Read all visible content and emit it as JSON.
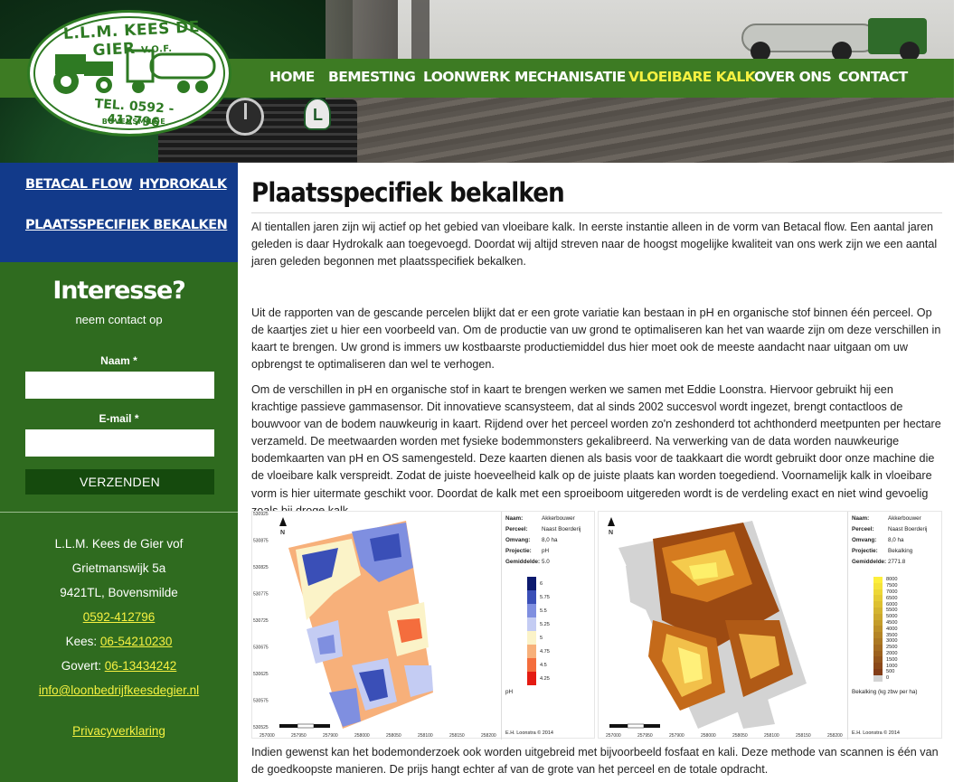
{
  "logo": {
    "title": "L.L.M. KEES DE GIER",
    "suffix": "V.O.F.",
    "phone": "TEL. 0592 - 412796",
    "town": "BOVENSMILDE"
  },
  "nav": {
    "items": [
      "HOME",
      "BEMESTING",
      "LOONWERK",
      "MECHANISATIE",
      "VLOEIBARE KALK",
      "OVER ONS",
      "CONTACT"
    ],
    "active": "VLOEIBARE KALK",
    "active_color": "#f6f141"
  },
  "sidebar": {
    "sub_links": [
      "BETACAL FLOW",
      "HYDROKALK",
      "PLAATSSPECIFIEK BEKALKEN"
    ],
    "interest_title": "Interesse?",
    "interest_sub": "neem contact op",
    "name_label": "Naam *",
    "email_label": "E-mail *",
    "submit_label": "VERZENDEN",
    "company": "L.L.M. Kees de Gier vof",
    "street": "Grietmanswijk 5a",
    "city": "9421TL, Bovensmilde",
    "phone": "0592-412796",
    "kees_label": "Kees:",
    "kees_phone": "06-54210230",
    "govert_label": "Govert:",
    "govert_phone": "06-13434242",
    "email": "info@loonbedrijfkeesdegier.nl",
    "privacy": "Privacyverklaring"
  },
  "main": {
    "title": "Plaatsspecifiek bekalken",
    "p1": "Al tientallen jaren zijn wij actief op het gebied van vloeibare kalk. In eerste instantie alleen in de vorm van Betacal flow. Een aantal jaren geleden is daar Hydrokalk aan toegevoegd. Doordat wij altijd streven naar de hoogst mogelijke kwaliteit van ons werk zijn we een aantal jaren geleden begonnen met plaatsspecifiek bekalken.",
    "p2": "Uit de rapporten van de gescande percelen blijkt dat er een grote variatie kan bestaan in pH en organische stof binnen één perceel. Op de kaartjes ziet u hier een voorbeeld van. Om de productie van uw grond te optimaliseren kan het van waarde zijn om deze verschillen in kaart te brengen. Uw grond is immers uw kostbaarste productiemiddel dus hier moet ook de meeste aandacht naar uitgaan om uw opbrengst te optimaliseren dan wel te verhogen.",
    "p3": "Om de verschillen in pH en organische stof in kaart te brengen werken we samen met Eddie Loonstra. Hiervoor gebruikt hij een krachtige passieve gammasensor. Dit innovatieve scansysteem, dat al sinds 2002 succesvol wordt ingezet, brengt contactloos de bouwvoor van de bodem nauwkeurig in kaart. Rijdend over het perceel worden zo'n zeshonderd tot achthonderd meetpunten per hectare verzameld. De meetwaarden worden met fysieke bodemmonsters gekalibreerd. Na verwerking van de data worden nauwkeurige bodemkaarten van pH en OS samengesteld. Deze kaarten dienen als basis voor de taakkaart die wordt gebruikt door onze machine die de vloeibare kalk verspreidt. Zodat de juiste hoeveelheid kalk op de juiste plaats kan worden toegediend. Voornamelijk kalk in vloeibare vorm is hier uitermate geschikt voor. Doordat de kalk met een sproeiboom uitgereden wordt is de verdeling exact en niet wind gevoelig zoals bij droge kalk.",
    "p4": "Indien gewenst kan het bodemonderzoek ook worden uitgebreid met bijvoorbeeld fosfaat en kali. Deze methode van scannen is één van de goedkoopste manieren. De prijs hangt echter af van de grote van het perceel en de totale opdracht."
  },
  "maps": {
    "ph_map": {
      "naam_label": "Naam:",
      "naam": "Akkerbouwer",
      "perceel_label": "Perceel:",
      "perceel": "Naast Boerderij",
      "omvang_label": "Omvang:",
      "omvang": "8,0 ha",
      "projectie_label": "Projectie:",
      "projectie": "pH",
      "gem_label": "Gemiddelde:",
      "gem": "5.0",
      "legend": [
        "6",
        "5.75",
        "5.5",
        "5.25",
        "5",
        "4.75",
        "4.5",
        "4.25"
      ],
      "legend_colors": [
        "#0c1a6e",
        "#3a4fb7",
        "#7f8fe0",
        "#c4ccf3",
        "#fbf3c8",
        "#f7b07a",
        "#f46d3d",
        "#e41b12"
      ],
      "unit": "pH",
      "credit": "E.H. Loonstra © 2014"
    },
    "kalk_map": {
      "naam_label": "Naam:",
      "naam": "Akkerbouwer",
      "perceel_label": "Perceel:",
      "perceel": "Naast Boerderij",
      "omvang_label": "Omvang:",
      "omvang": "8,0 ha",
      "projectie_label": "Projectie:",
      "projectie": "Bekalking",
      "gem_label": "Gemiddelde:",
      "gem": "2771.8",
      "legend": [
        "8000",
        "7500",
        "7000",
        "6500",
        "6000",
        "5500",
        "5000",
        "4500",
        "4000",
        "3500",
        "3000",
        "2500",
        "2000",
        "1500",
        "1000",
        "500",
        "0"
      ],
      "unit": "Bekalking (kg zbw per ha)",
      "credit": "E.H. Loonstra © 2014"
    },
    "scale_ticks": [
      "0",
      "25",
      "50",
      "75",
      "100"
    ],
    "y_ticks": [
      "530925",
      "530875",
      "530825",
      "530775",
      "530725",
      "530675",
      "530625",
      "530575",
      "530525"
    ],
    "x_ticks": [
      "257000",
      "257950",
      "257900",
      "258000",
      "258050",
      "258100",
      "258150",
      "258200"
    ]
  }
}
